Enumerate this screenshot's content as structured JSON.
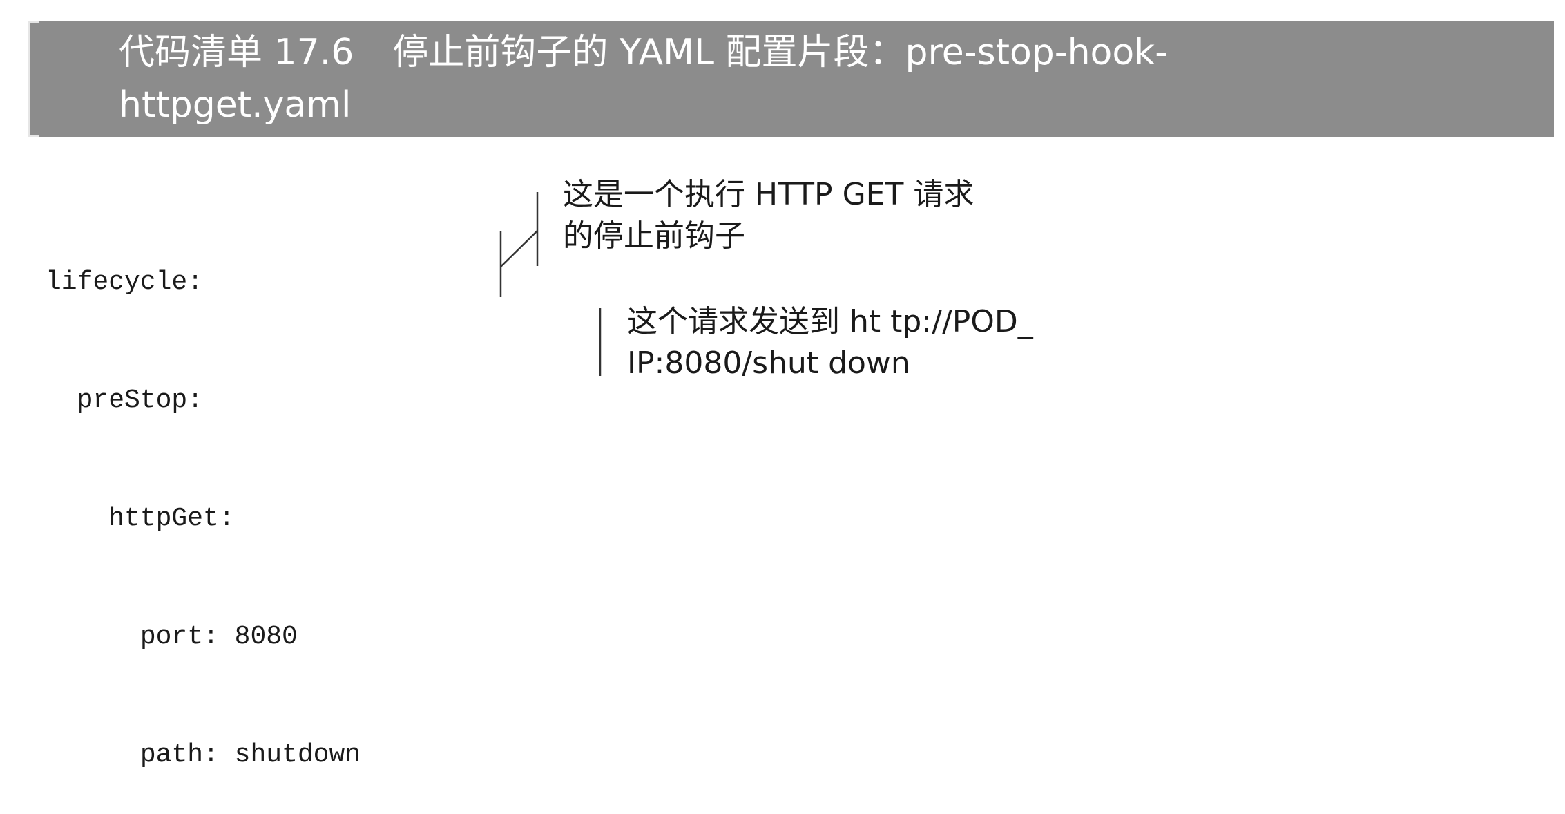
{
  "header": {
    "listing_number": "代码清单 17.6",
    "title_line1": "停止前钩子的 YAML 配置片段：pre-stop-hook-",
    "title_line2": "httpget.yaml"
  },
  "code": {
    "lines": [
      "lifecycle:",
      "  preStop:",
      "    httpGet:",
      "      port: 8080",
      "      path: shutdown"
    ]
  },
  "annotations": [
    {
      "line1": "这是一个执行 HTTP GET 请求",
      "line2": "的停止前钩子"
    },
    {
      "line1": "这个请求发送到 ht tp://POD_",
      "line2": "IP:8080/shut down"
    }
  ],
  "colors": {
    "banner_bg": "#8c8c8c",
    "banner_text": "#ffffff",
    "body_text": "#1a1a1a"
  }
}
